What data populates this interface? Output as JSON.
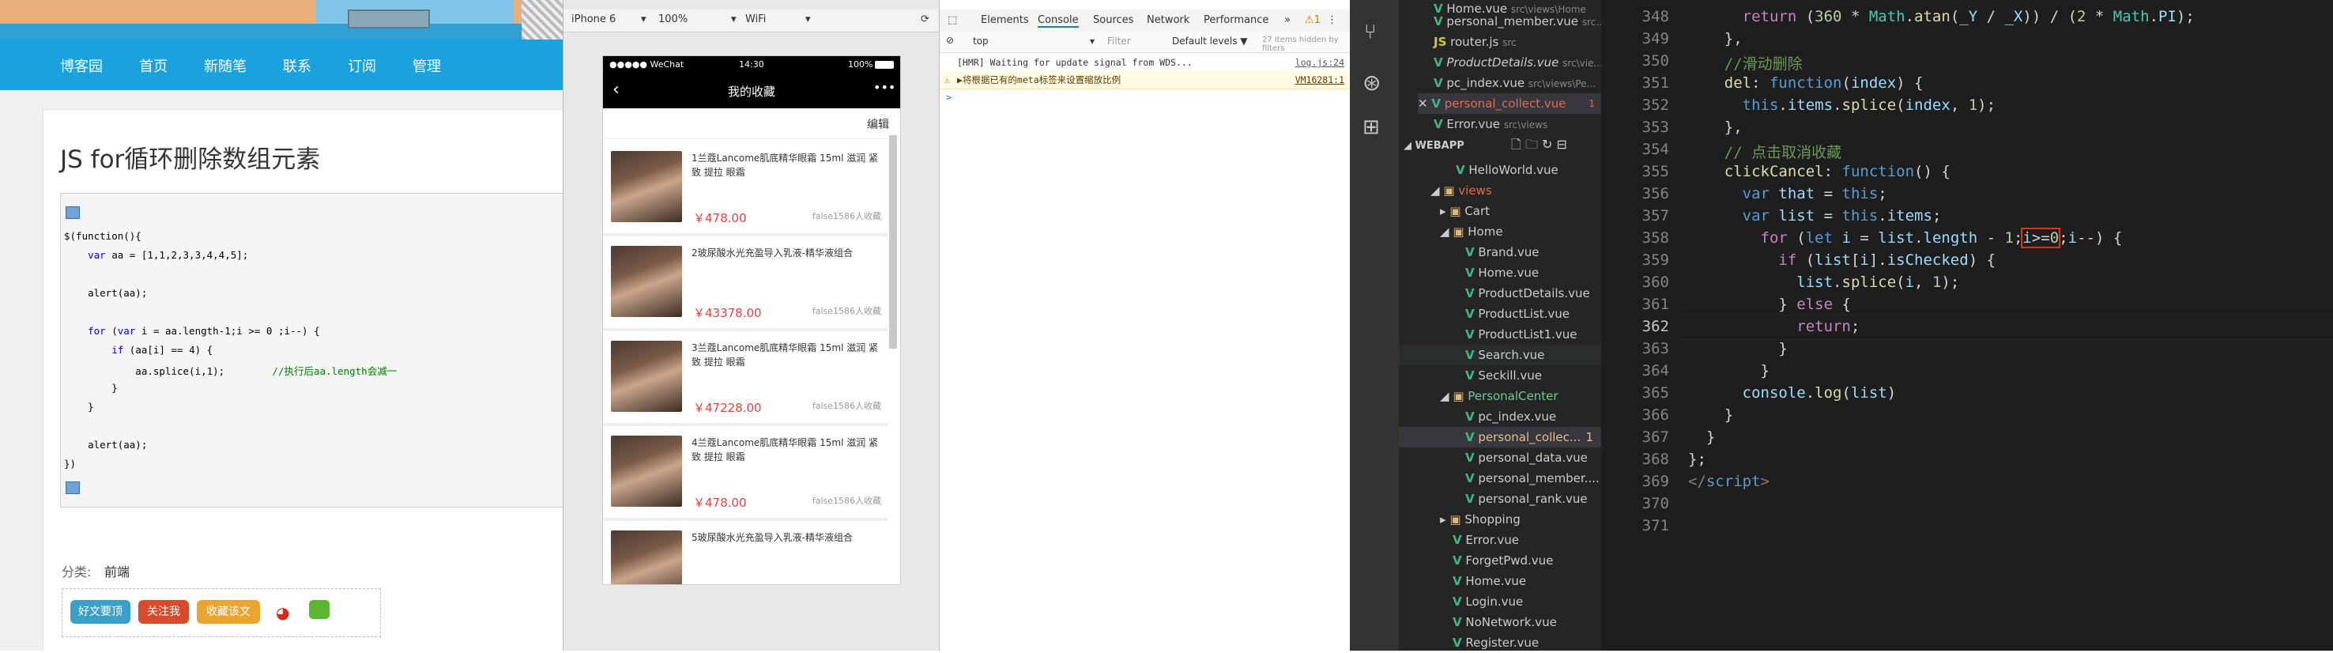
{
  "blog": {
    "nav": [
      "博客园",
      "首页",
      "新随笔",
      "联系",
      "订阅",
      "管理"
    ],
    "title": "JS for循环删除数组元素",
    "code": [
      "$(function(){",
      "    var aa = [1,1,2,3,3,4,4,5];",
      "",
      "    alert(aa);",
      "",
      "    for (var i = aa.length-1;i >= 0 ;i--) {",
      "        if (aa[i] == 4) {",
      "            aa.splice(i,1);",
      "        }",
      "    }",
      "",
      "    alert(aa);",
      "})"
    ],
    "code_comment": "//执行后aa.length会减一",
    "category_label": "分类:",
    "category_value": "前端",
    "share_buttons": [
      "好文要顶",
      "关注我",
      "收藏该文"
    ]
  },
  "emulator": {
    "device": "iPhone 6",
    "zoom": "100%",
    "network": "WiFi",
    "phone": {
      "carrier": "●●●●● WeChat",
      "time": "14:30",
      "battery": "100%",
      "page_title": "我的收藏",
      "back_icon": "chevron-left-icon",
      "more_icon": "more-icon",
      "edit_label": "编辑",
      "items": [
        {
          "title": "1兰蔻Lancome肌底精华眼霜 15ml 滋润 紧致 提拉 眼霜",
          "price": "￥478.00",
          "meta": "false1586人收藏"
        },
        {
          "title": "2玻尿酸水光充盈导入乳液-精华液组合",
          "price": "￥43378.00",
          "meta": "false1586人收藏"
        },
        {
          "title": "3兰蔻Lancome肌底精华眼霜 15ml 滋润 紧致 提拉 眼霜",
          "price": "￥47228.00",
          "meta": "false1586人收藏"
        },
        {
          "title": "4兰蔻Lancome肌底精华眼霜 15ml 滋润 紧致 提拉 眼霜",
          "price": "￥478.00",
          "meta": "false1586人收藏"
        },
        {
          "title": "5玻尿酸水光充盈导入乳液-精华液组合",
          "price": "",
          "meta": ""
        }
      ]
    }
  },
  "devtools": {
    "tabs": [
      "Elements",
      "Console",
      "Sources",
      "Network",
      "Performance"
    ],
    "warning_count": "1",
    "context": "top",
    "filter_placeholder": "Filter",
    "levels": "Default levels ▼",
    "hidden_note": "27 items hidden by filters",
    "logs": [
      {
        "text": "[HMR] Waiting for update signal from WDS...",
        "src": "log.js:24"
      },
      {
        "text": "▶将根据已有的meta标签来设置缩放比例",
        "src": "VM16281:1"
      }
    ],
    "prompt": ">"
  },
  "vscode": {
    "open_files": [
      {
        "name": "Home.vue",
        "path": "src\\views\\Home",
        "type": "vue"
      },
      {
        "name": "personal_member.vue",
        "path": "src...",
        "type": "vue"
      },
      {
        "name": "router.js",
        "path": "src",
        "type": "js"
      },
      {
        "name": "ProductDetails.vue",
        "path": "src\\vie...",
        "type": "vue"
      },
      {
        "name": "pc_index.vue",
        "path": "src\\views\\Pe...",
        "type": "vue"
      },
      {
        "name": "personal_collect.vue",
        "path": "...",
        "type": "vue",
        "badge": "1"
      },
      {
        "name": "Error.vue",
        "path": "src\\views",
        "type": "vue"
      }
    ],
    "workspace": "WEBAPP",
    "tree": [
      {
        "name": "HelloWorld.vue",
        "depth": 3,
        "type": "vue"
      },
      {
        "name": "views",
        "depth": 2,
        "type": "folder"
      },
      {
        "name": "Cart",
        "depth": 3,
        "type": "folder-closed"
      },
      {
        "name": "Home",
        "depth": 3,
        "type": "folder"
      },
      {
        "name": "Brand.vue",
        "depth": 4,
        "type": "vue"
      },
      {
        "name": "Home.vue",
        "depth": 4,
        "type": "vue"
      },
      {
        "name": "ProductDetails.vue",
        "depth": 4,
        "type": "vue"
      },
      {
        "name": "ProductList.vue",
        "depth": 4,
        "type": "vue"
      },
      {
        "name": "ProductList1.vue",
        "depth": 4,
        "type": "vue"
      },
      {
        "name": "Search.vue",
        "depth": 4,
        "type": "vue"
      },
      {
        "name": "Seckill.vue",
        "depth": 4,
        "type": "vue"
      },
      {
        "name": "PersonalCenter",
        "depth": 3,
        "type": "folder"
      },
      {
        "name": "pc_index.vue",
        "depth": 4,
        "type": "vue"
      },
      {
        "name": "personal_collec...",
        "depth": 4,
        "type": "vue",
        "badge": "1"
      },
      {
        "name": "personal_data.vue",
        "depth": 4,
        "type": "vue"
      },
      {
        "name": "personal_member....",
        "depth": 4,
        "type": "vue"
      },
      {
        "name": "personal_rank.vue",
        "depth": 4,
        "type": "vue"
      },
      {
        "name": "Shopping",
        "depth": 3,
        "type": "folder-closed"
      },
      {
        "name": "Error.vue",
        "depth": 3,
        "type": "vue"
      },
      {
        "name": "ForgetPwd.vue",
        "depth": 3,
        "type": "vue"
      },
      {
        "name": "Home.vue",
        "depth": 3,
        "type": "vue"
      },
      {
        "name": "Login.vue",
        "depth": 3,
        "type": "vue"
      },
      {
        "name": "NoNetwork.vue",
        "depth": 3,
        "type": "vue"
      },
      {
        "name": "Register.vue",
        "depth": 3,
        "type": "vue"
      }
    ],
    "line_numbers": [
      "348",
      "349",
      "350",
      "351",
      "352",
      "353",
      "354",
      "355",
      "356",
      "357",
      "358",
      "359",
      "360",
      "361",
      "362",
      "363",
      "364",
      "365",
      "366",
      "367",
      "368",
      "369",
      "370",
      "371"
    ],
    "current_line": "362",
    "comments": [
      "//滑动删除",
      "// 点击取消收藏"
    ]
  }
}
